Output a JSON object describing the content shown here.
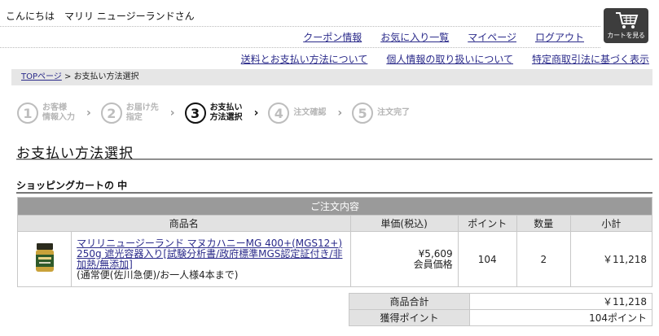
{
  "header": {
    "greeting": "こんにちは　マリリ ニュージーランドさん",
    "cart_button_label": "カートを見る"
  },
  "nav_primary": [
    "クーポン情報",
    "お気に入り一覧",
    "マイページ",
    "ログアウト"
  ],
  "nav_secondary": [
    "送料とお支払い方法について",
    "個人情報の取り扱いについて",
    "特定商取引法に基づく表示"
  ],
  "breadcrumb": {
    "home": "TOPページ",
    "separator": " > ",
    "current": "お支払い方法選択"
  },
  "steps": [
    {
      "num": "1",
      "line1": "お客様",
      "line2": "情報入力"
    },
    {
      "num": "2",
      "line1": "お届け先",
      "line2": "指定"
    },
    {
      "num": "3",
      "line1": "お支払い",
      "line2": "方法選択"
    },
    {
      "num": "4",
      "line1": "注文確認",
      "line2": ""
    },
    {
      "num": "5",
      "line1": "注文完了",
      "line2": ""
    }
  ],
  "page_title": "お支払い方法選択",
  "section_title": "ショッピングカートの 中",
  "order_table": {
    "caption": "ご注文内容",
    "headers": [
      "商品名",
      "単価(税込)",
      "ポイント",
      "数量",
      "小計"
    ],
    "item": {
      "name": "マリリニュージーランド マヌカハニーMG 400+(MGS12+) 250g 遮光容器入り[試験分析書/政府標準MGS認定証付き/非加熱/無添加]",
      "note": "(通常便(佐川急便)/お一人様4本まで)",
      "price": "¥5,609",
      "price_note": "会員価格",
      "points": "104",
      "quantity": "2",
      "subtotal": "￥11,218"
    }
  },
  "totals": {
    "product_total_label": "商品合計",
    "product_total_value": "￥11,218",
    "points_label": "獲得ポイント",
    "points_value": "104ポイント"
  },
  "colors": {
    "link": "#2a2a8a",
    "table_caption_bg": "#9a9a9a",
    "table_header_bg": "#e2e2e2",
    "cart_button_bg": "#3d3d3d"
  }
}
